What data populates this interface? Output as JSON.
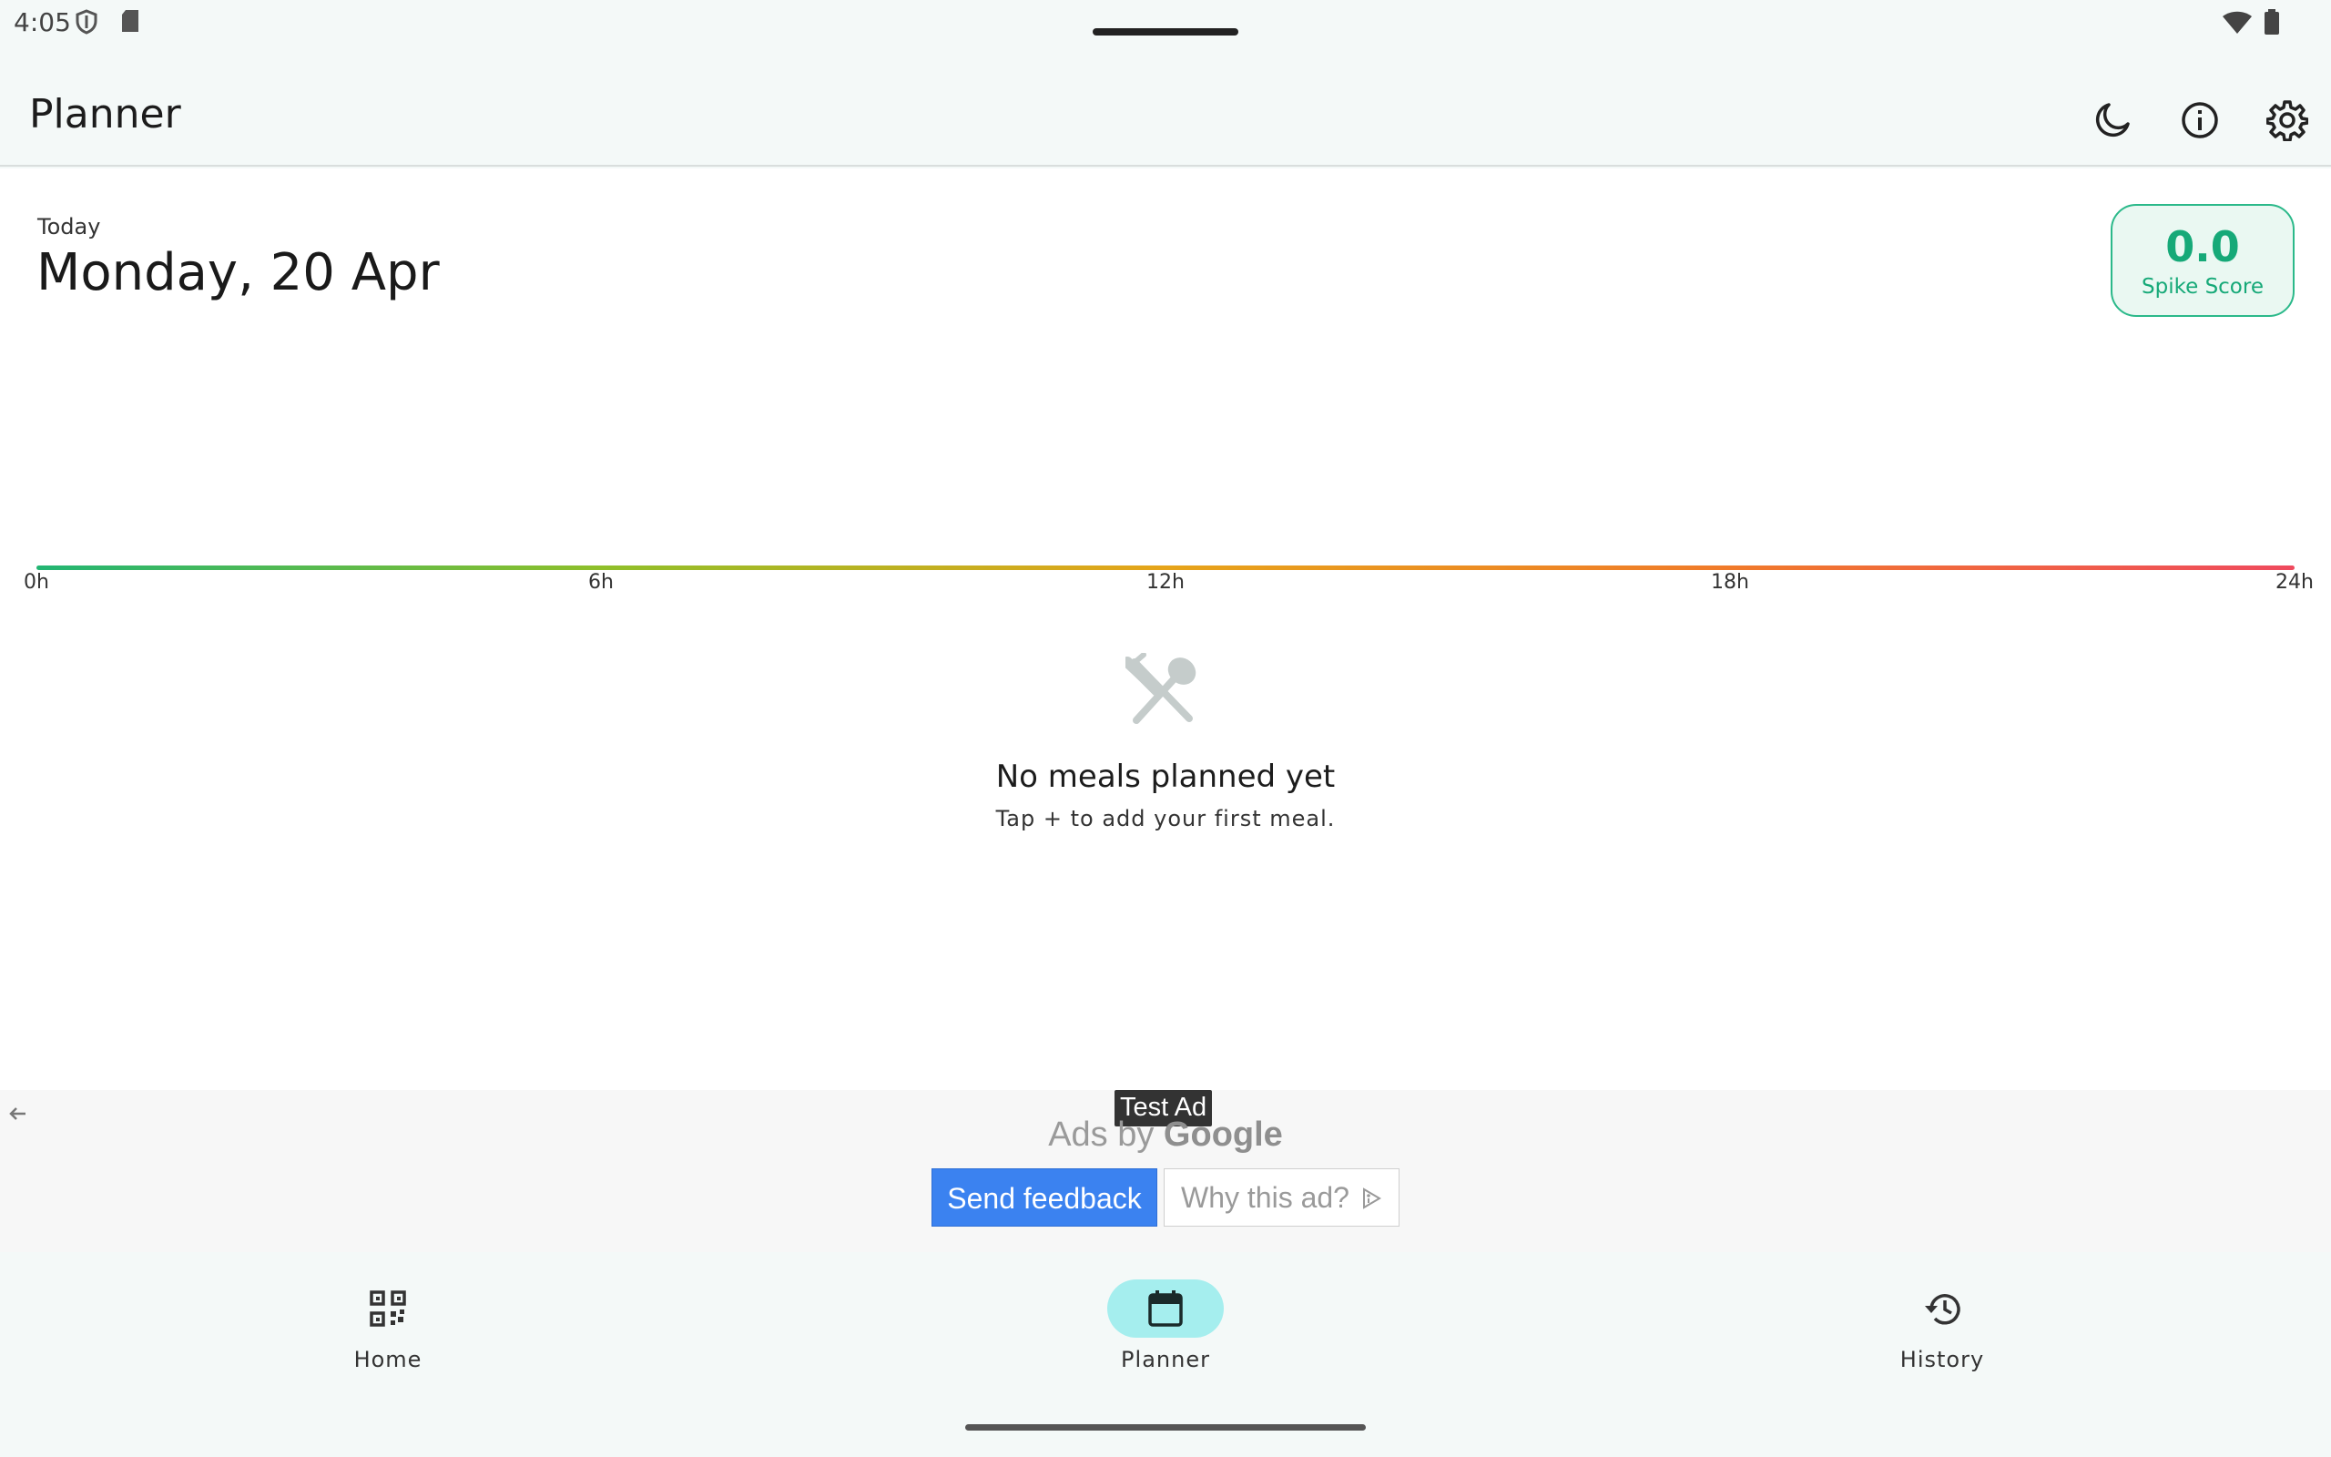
{
  "status_bar": {
    "time": "4:05"
  },
  "app_bar": {
    "title": "Planner",
    "actions": [
      "moon-icon",
      "info-icon",
      "settings-icon"
    ]
  },
  "main": {
    "today_label": "Today",
    "date": "Monday, 20 Apr",
    "spike": {
      "value": "0.0",
      "label": "Spike Score",
      "color": "#16a978"
    },
    "timeline": {
      "ticks": [
        "0h",
        "6h",
        "12h",
        "18h",
        "24h"
      ],
      "gradient": [
        "#22b573",
        "#8fbf2a",
        "#e6a41a",
        "#f07a2a",
        "#ef4a5e"
      ]
    },
    "empty": {
      "icon": "utensils-icon",
      "title": "No meals planned yet",
      "subtitle": "Tap + to add your first meal."
    },
    "fab_label": "+"
  },
  "ad": {
    "test_ad": "Test Ad",
    "ads_by": "Ads by",
    "google": "Google",
    "send_feedback": "Send feedback",
    "why_ad": "Why this ad?"
  },
  "nav": {
    "items": [
      {
        "label": "Home",
        "icon": "qr-code-icon",
        "active": false
      },
      {
        "label": "Planner",
        "icon": "calendar-icon",
        "active": true
      },
      {
        "label": "History",
        "icon": "history-icon",
        "active": false
      }
    ]
  }
}
